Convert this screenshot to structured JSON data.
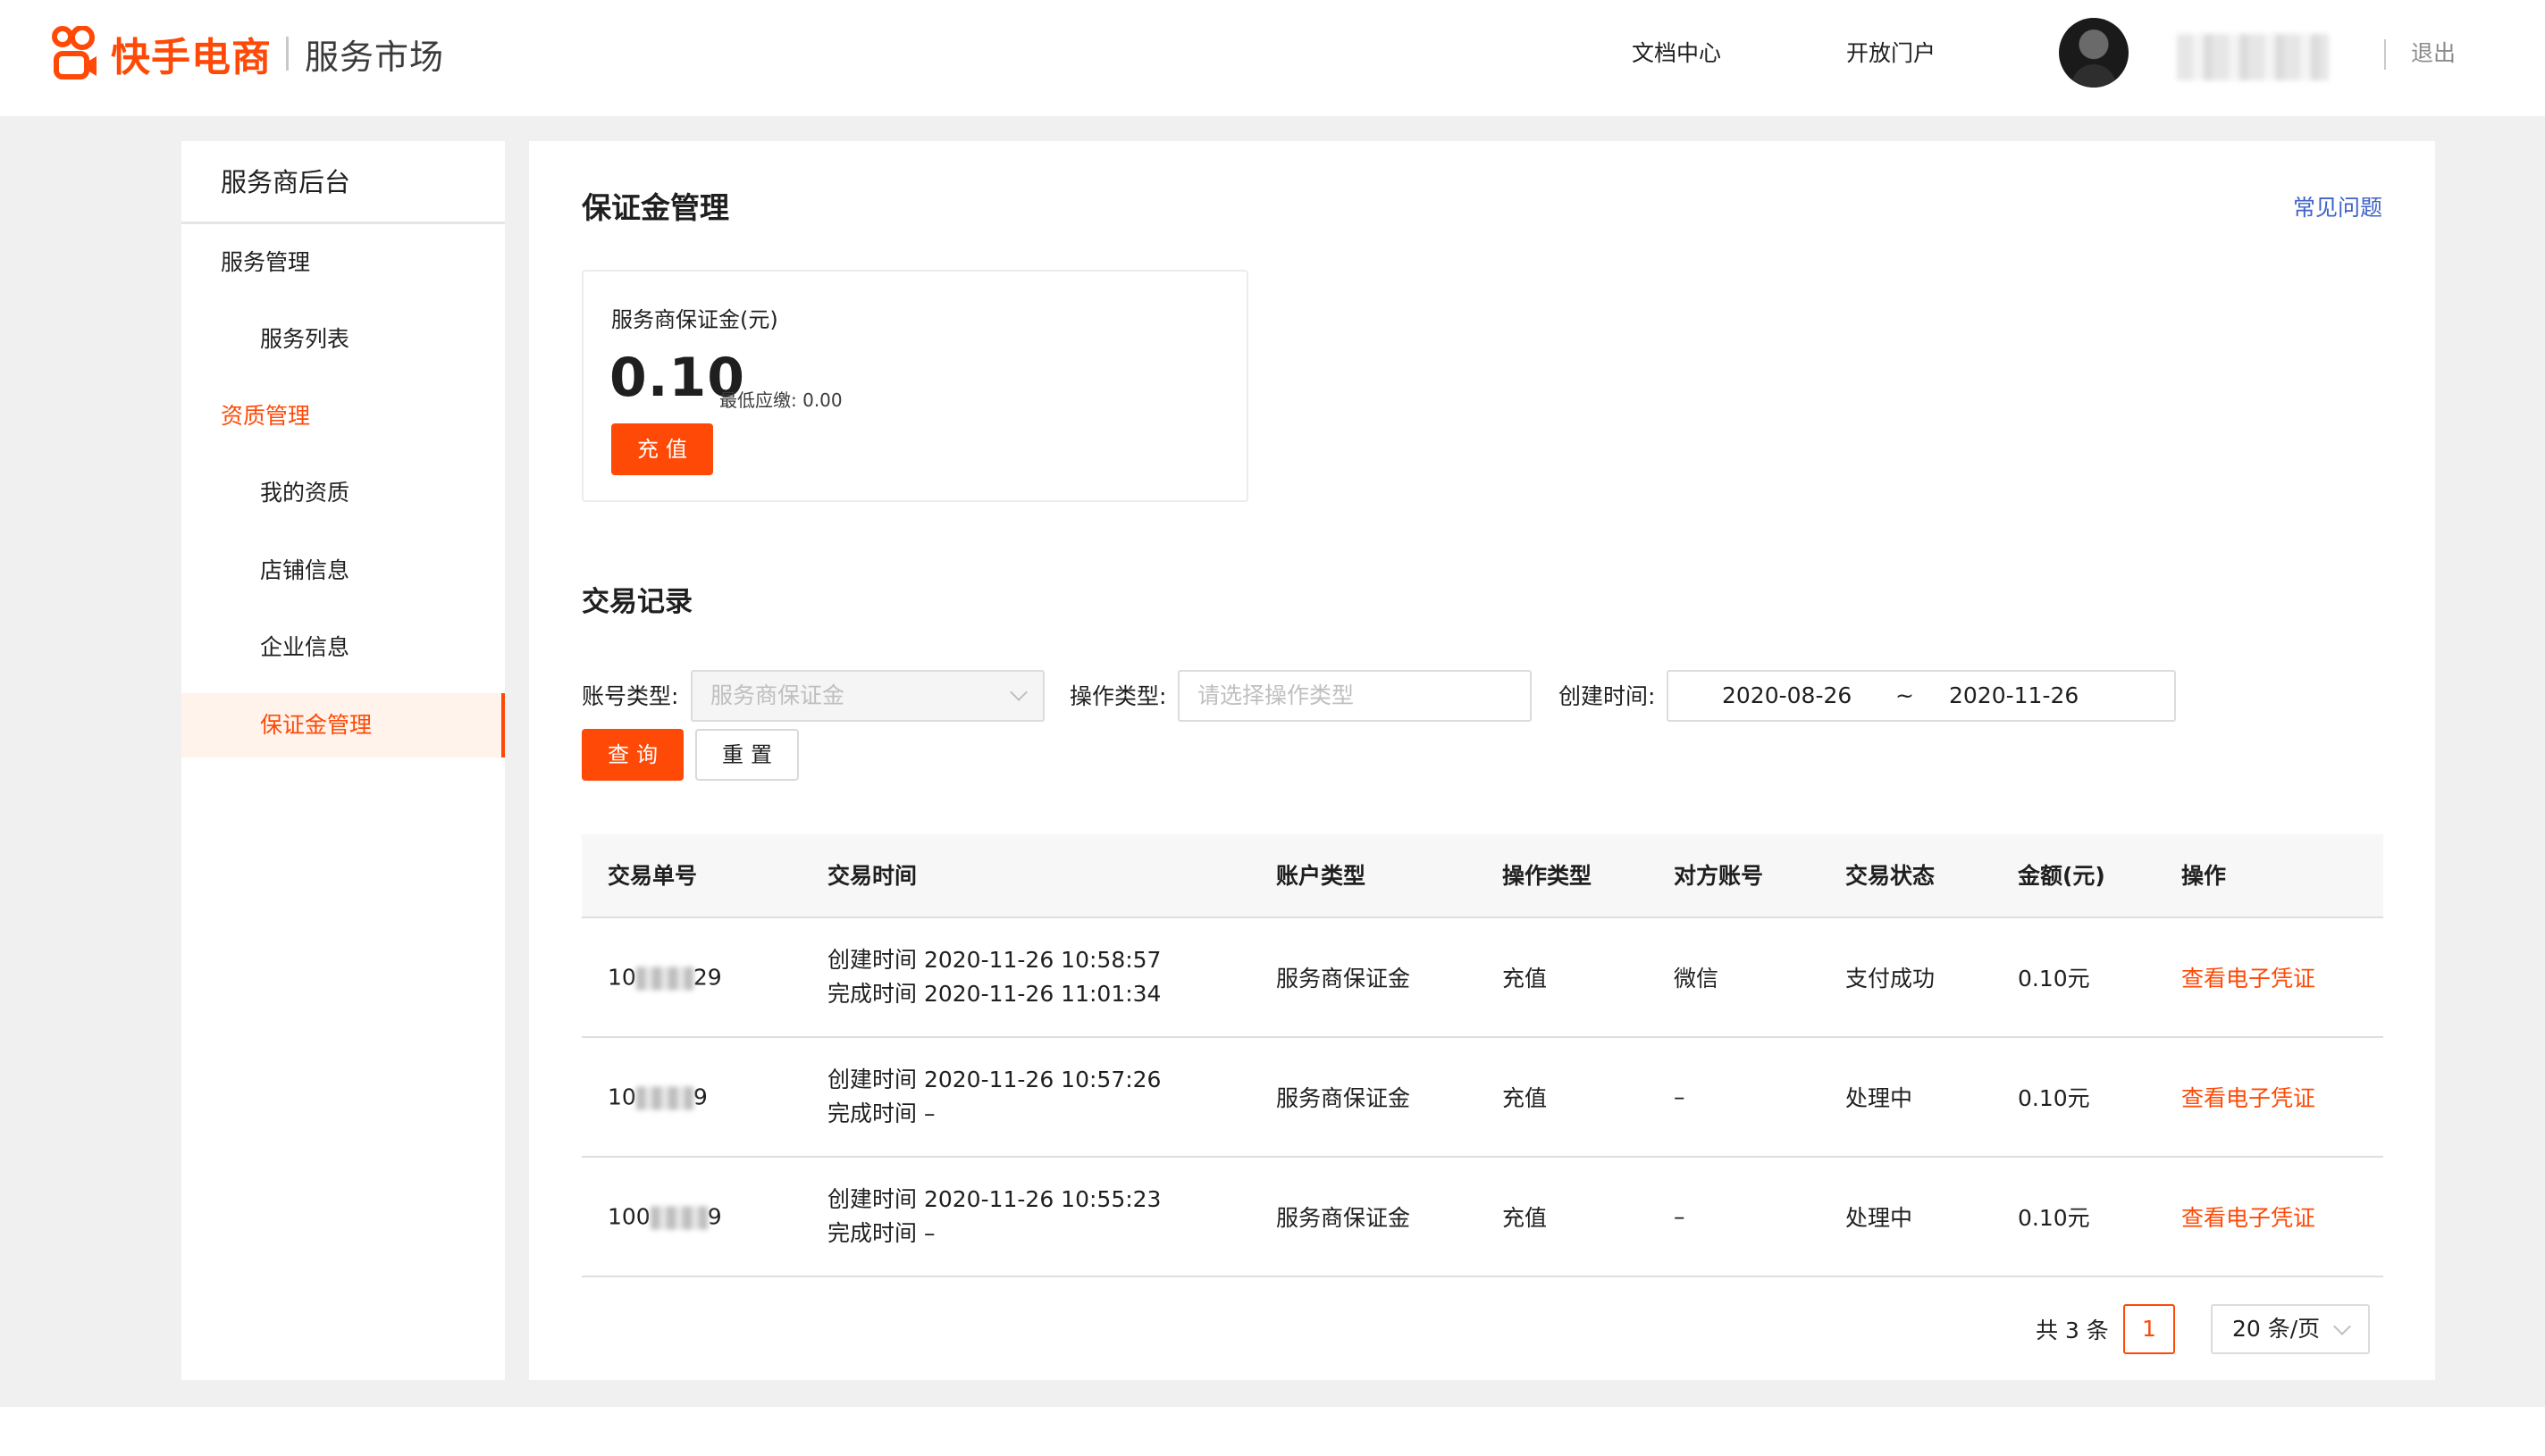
{
  "header": {
    "brand": "快手电商",
    "brand_sub": "服务市场",
    "nav": [
      "文档中心",
      "开放门户"
    ],
    "logout": "退出"
  },
  "sidebar": {
    "title": "服务商后台",
    "items": [
      {
        "label": "服务管理",
        "level": 1
      },
      {
        "label": "服务列表",
        "level": 2
      },
      {
        "label": "资质管理",
        "level": 1
      },
      {
        "label": "我的资质",
        "level": 2
      },
      {
        "label": "店铺信息",
        "level": 2
      },
      {
        "label": "企业信息",
        "level": 2
      },
      {
        "label": "保证金管理",
        "level": 2
      }
    ]
  },
  "main": {
    "title": "保证金管理",
    "faq": "常见问题",
    "deposit": {
      "label": "服务商保证金(元)",
      "amount": "0.10",
      "min": "最低应缴: 0.00",
      "recharge": "充值"
    },
    "records_title": "交易记录",
    "filters": {
      "account_type_label": "账号类型:",
      "account_type_value": "服务商保证金",
      "op_type_label": "操作类型:",
      "op_type_placeholder": "请选择操作类型",
      "created_label": "创建时间:",
      "date_from": "2020-08-26",
      "date_sep": "~",
      "date_to": "2020-11-26",
      "query": "查询",
      "reset": "重置"
    },
    "table": {
      "headers": [
        "交易单号",
        "交易时间",
        "账户类型",
        "操作类型",
        "对方账号",
        "交易状态",
        "金额(元)",
        "操作"
      ],
      "rows": [
        {
          "id_prefix": "10",
          "id_suffix": "29",
          "created": "创建时间 2020-11-26 10:58:57",
          "completed": "完成时间 2020-11-26 11:01:34",
          "account": "服务商保证金",
          "op": "充值",
          "counterparty": "微信",
          "status": "支付成功",
          "amount": "0.10元",
          "action": "查看电子凭证"
        },
        {
          "id_prefix": "10",
          "id_suffix": "9",
          "created": "创建时间 2020-11-26 10:57:26",
          "completed": "完成时间 –",
          "account": "服务商保证金",
          "op": "充值",
          "counterparty": "–",
          "status": "处理中",
          "amount": "0.10元",
          "action": "查看电子凭证"
        },
        {
          "id_prefix": "100",
          "id_suffix": "9",
          "created": "创建时间 2020-11-26 10:55:23",
          "completed": "完成时间 –",
          "account": "服务商保证金",
          "op": "充值",
          "counterparty": "–",
          "status": "处理中",
          "amount": "0.10元",
          "action": "查看电子凭证"
        }
      ]
    },
    "pagination": {
      "total": "共 3 条",
      "current": "1",
      "page_size": "20 条/页"
    }
  },
  "colors": {
    "accent": "#ff4906",
    "link_blue": "#3f63c8",
    "background": "#f0f0f0"
  }
}
